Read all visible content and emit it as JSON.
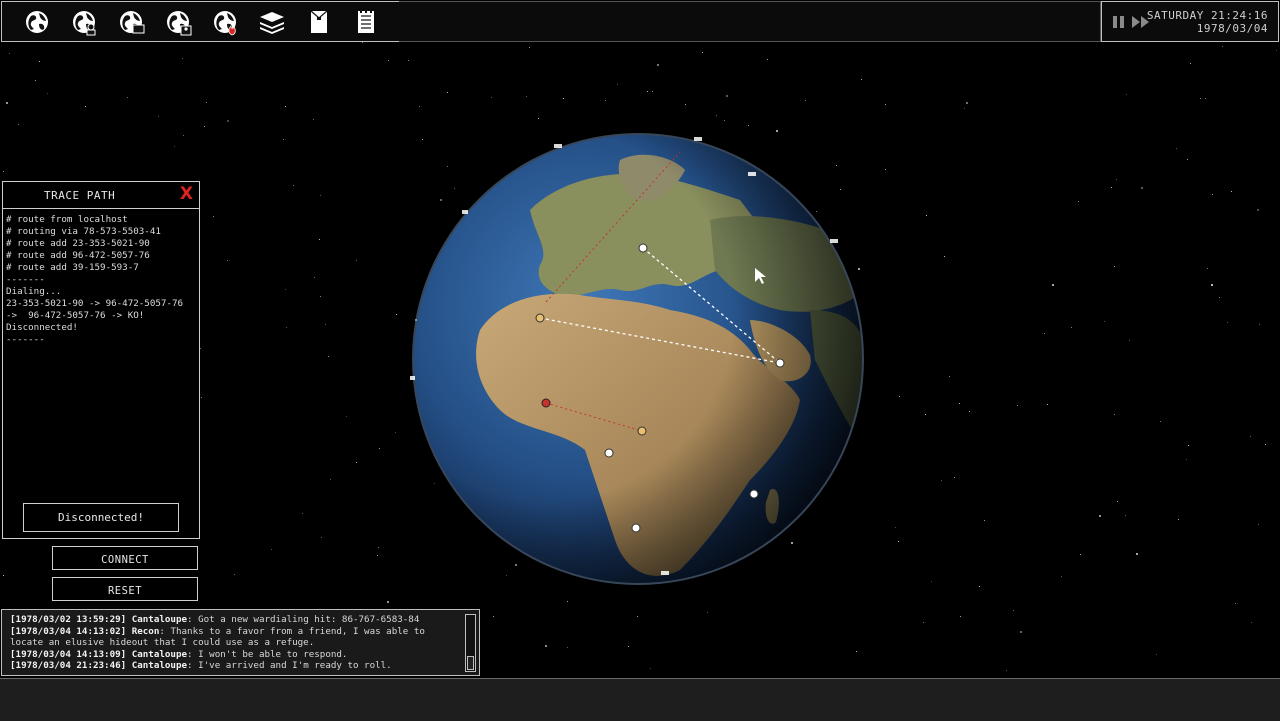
{
  "toolbar": {
    "tools": [
      {
        "icon": "globe-icon"
      },
      {
        "icon": "globe-user-icon"
      },
      {
        "icon": "globe-monitor-icon"
      },
      {
        "icon": "globe-people-icon"
      },
      {
        "icon": "globe-fire-icon"
      },
      {
        "icon": "stack-icon"
      },
      {
        "icon": "envelope-icon"
      },
      {
        "icon": "notepad-icon"
      }
    ]
  },
  "clock": {
    "line1": "SATURDAY 21:24:16",
    "line2": "1978/03/04"
  },
  "trace_panel": {
    "title": "TRACE PATH",
    "close": "X",
    "log_lines": [
      "# route from localhost",
      "# routing via 78-573-5503-41",
      "# route add 23-353-5021-90",
      "# route add 96-472-5057-76",
      "# route add 39-159-593-7",
      "-------",
      "Dialing...",
      "23-353-5021-90 -> 96-472-5057-76",
      "->  96-472-5057-76 -> KO!",
      "Disconnected!",
      "-------"
    ],
    "status": "Disconnected!"
  },
  "buttons": {
    "connect": "CONNECT",
    "reset": "RESET"
  },
  "chat": {
    "messages": [
      {
        "stamp": "[1978/03/02 13:59:29]",
        "sender": "Cantaloupe",
        "text": ": Got a new wardialing hit: 86-767-6583-84"
      },
      {
        "stamp": "[1978/03/04 14:13:02]",
        "sender": "Recon",
        "text": ": Thanks to a favor from a friend, I was able to\nlocate an elusive hideout that I could use as a refuge."
      },
      {
        "stamp": "[1978/03/04 14:13:09]",
        "sender": "Cantaloupe",
        "text": ": I won't be able to respond."
      },
      {
        "stamp": "[1978/03/04 21:23:46]",
        "sender": "Cantaloupe",
        "text": ": I've arrived and I'm ready to roll."
      }
    ]
  },
  "colors": {
    "close_red": "#e0231f",
    "route_white": "#ffffff",
    "route_red": "#c8322c",
    "node_gold": "#e8c070"
  }
}
